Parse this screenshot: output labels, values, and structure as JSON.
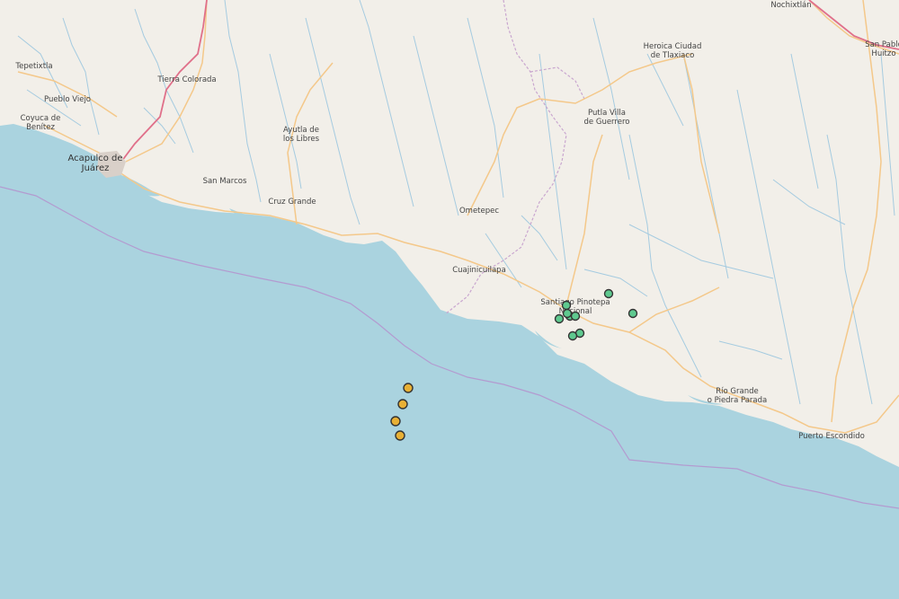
{
  "map": {
    "colors": {
      "land": "#f2efe9",
      "water": "#aad3df",
      "river": "#a5cbe0",
      "major_road": "#f4c88a",
      "highway": "#e0708a",
      "state_border": "#c9a6cf",
      "marker_land": "#5fc98f",
      "marker_sea": "#e8b035"
    },
    "labels": [
      {
        "name": "label-nochixtlan",
        "lines": [
          "Nochixtlán"
        ]
      },
      {
        "name": "label-san-pablo-huitzo",
        "lines": [
          "San Pablo",
          "Huitzo"
        ]
      },
      {
        "name": "label-tepetixtla",
        "lines": [
          "Tepetixtla"
        ]
      },
      {
        "name": "label-tierra-colorada",
        "lines": [
          "Tierra Colorada"
        ]
      },
      {
        "name": "label-heroica-ciudad-de-tlaxiaco",
        "lines": [
          "Heroica Ciudad",
          "de Tlaxiaco"
        ]
      },
      {
        "name": "label-pueblo-viejo",
        "lines": [
          "Pueblo Viejo"
        ]
      },
      {
        "name": "label-putla-villa-de-guerrero",
        "lines": [
          "Putla Villa",
          "de Guerrero"
        ]
      },
      {
        "name": "label-coyuca-de-benitez",
        "lines": [
          "Coyuca de",
          "Benítez"
        ]
      },
      {
        "name": "label-ayutla-de-los-libres",
        "lines": [
          "Ayutla de",
          "los Libres"
        ]
      },
      {
        "name": "label-acapulco-de-juarez",
        "lines": [
          "Acapulco de",
          "Juárez"
        ]
      },
      {
        "name": "label-san-marcos",
        "lines": [
          "San Marcos"
        ]
      },
      {
        "name": "label-cruz-grande",
        "lines": [
          "Cruz Grande"
        ]
      },
      {
        "name": "label-ometepec",
        "lines": [
          "Ometepec"
        ]
      },
      {
        "name": "label-cuajinicuilapa",
        "lines": [
          "Cuajinicuilapa"
        ]
      },
      {
        "name": "label-santiago-pinotepa-nacional",
        "lines": [
          "Santiago Pinotepa",
          "Nacional"
        ]
      },
      {
        "name": "label-rio-grande-o-piedra-parada",
        "lines": [
          "Río Grande",
          "o Piedra Parada"
        ]
      },
      {
        "name": "label-puerto-escondido",
        "lines": [
          "Puerto Escondido"
        ]
      }
    ],
    "markers_land_count": 9,
    "markers_sea_count": 4
  }
}
